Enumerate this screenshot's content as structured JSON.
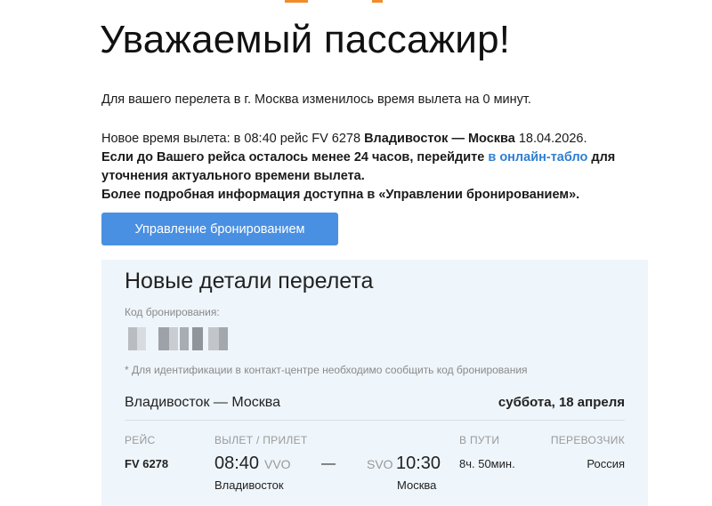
{
  "header": {
    "greeting": "Уважаемый пассажир!"
  },
  "notice": {
    "line1": "Для вашего перелета в г. Москва изменилось время вылета на 0 минут.",
    "new_time_prefix": "Новое время вылета: в 08:40 рейс FV 6278 ",
    "new_time_route": "Владивосток — Москва",
    "new_time_date": " 18.04.2026.",
    "advice_before_link": "Если до Вашего рейса осталось менее 24 часов, перейдите ",
    "advice_link": "в онлайн-табло",
    "advice_after_link": " для уточнения актуального времени вылета.",
    "more_info": "Более подробная информация доступна в «Управлении бронированием»."
  },
  "actions": {
    "manage_booking_label": "Управление бронированием"
  },
  "details": {
    "title": "Новые детали перелета",
    "booking_code_label": "Код бронирования:",
    "booking_code_note": "* Для идентификации в контакт-центре необходимо сообщить код бронирования",
    "route": "Владивосток — Москва",
    "date": "суббота, 18 апреля",
    "columns": {
      "flight": "Рейс",
      "dep_arr": "Вылет / прилет",
      "duration": "В пути",
      "carrier": "Перевозчик"
    },
    "segment": {
      "flight_number": "FV 6278",
      "departure_time": "08:40",
      "departure_code": "VVO",
      "separator": "—",
      "arrival_code": "SVO",
      "arrival_time": "10:30",
      "departure_city": "Владивосток",
      "arrival_city": "Москва",
      "duration": "8ч. 50мин.",
      "carrier": "Россия"
    }
  },
  "colors": {
    "accent_orange": "#f28c28",
    "button_blue": "#4a90e2",
    "link_blue": "#2e7fd3",
    "panel_bg": "#eef5fb"
  }
}
